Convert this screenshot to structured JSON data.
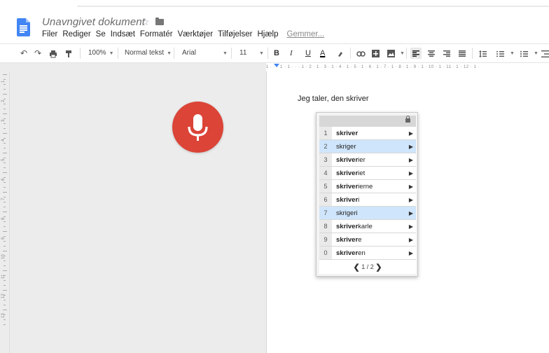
{
  "document": {
    "title": "Unavngivet dokument",
    "star_glyph": "☆"
  },
  "menubar": {
    "items": [
      "Filer",
      "Rediger",
      "Se",
      "Indsæt",
      "Formatér",
      "Værktøjer",
      "Tilføjelser",
      "Hjælp"
    ],
    "save_link": "Gemmer..."
  },
  "toolbar": {
    "zoom": "100%",
    "style": "Normal tekst",
    "font": "Arial",
    "font_size": "11",
    "bold": "B",
    "italic": "I",
    "underline": "U",
    "text_color": "A"
  },
  "ruler": {
    "labels": "1 · · · 1 · 1 · · · 1 · 2 · 1 · 3 · 1 · 4 · 1 · 5 · 1 · 6 · 1 · 7 · 1 · 8 · 1 · 9 · 1 · 10 · 1 · 11 · 1 · 12 · 1 ·"
  },
  "vertical_ruler": {
    "numbers": [
      "1",
      "2",
      "3",
      "4",
      "5",
      "6",
      "7",
      "8",
      "9",
      "10",
      "11",
      "12",
      "13"
    ]
  },
  "page": {
    "text": "Jeg taler, den skriver"
  },
  "voice_typing": {
    "mic_color": "#db4437"
  },
  "suggestions": {
    "items": [
      {
        "num": "1",
        "bold": "skriver",
        "rest": "",
        "highlighted": false
      },
      {
        "num": "2",
        "bold": "",
        "rest": "skriger",
        "highlighted": true
      },
      {
        "num": "3",
        "bold": "skriver",
        "rest": "ier",
        "highlighted": false
      },
      {
        "num": "4",
        "bold": "skriver",
        "rest": "iet",
        "highlighted": false
      },
      {
        "num": "5",
        "bold": "skriver",
        "rest": "ierne",
        "highlighted": false
      },
      {
        "num": "6",
        "bold": "skriver",
        "rest": "i",
        "highlighted": false
      },
      {
        "num": "7",
        "bold": "",
        "rest": "skrigeri",
        "highlighted": true
      },
      {
        "num": "8",
        "bold": "skriver",
        "rest": "karle",
        "highlighted": false
      },
      {
        "num": "9",
        "bold": "skriver",
        "rest": "e",
        "highlighted": false
      },
      {
        "num": "0",
        "bold": "skriver",
        "rest": "en",
        "highlighted": false
      }
    ],
    "pager": "1 / 2",
    "highlight_color": "#cfe5fb"
  }
}
